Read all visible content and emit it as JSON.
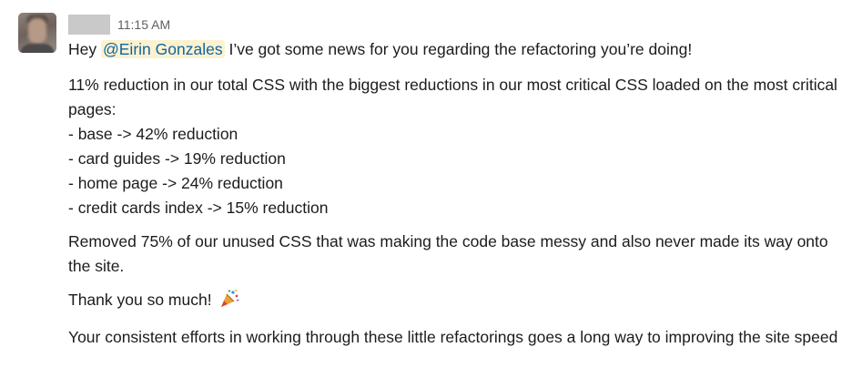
{
  "message": {
    "timestamp": "11:15 AM",
    "greeting": "Hey",
    "mention": "@Eirin Gonzales",
    "intro_rest": "I’ve got some news for you regarding the refactoring you’re doing!",
    "summary": "11% reduction in our total CSS with the biggest reductions in our most critical CSS loaded on the most critical pages:",
    "reductions": [
      "- base -> 42% reduction",
      "- card guides -> 19% reduction",
      "- home page -> 24% reduction",
      "- credit cards index -> 15% reduction"
    ],
    "unused": "Removed 75% of our unused CSS that was making the code base messy and also never made its way onto the site.",
    "thanks": "Thank you so much!",
    "thanks_emoji": "party-popper-icon",
    "closing": "Your consistent efforts in working through these little refactorings goes a long way to improving the site speed"
  },
  "colors": {
    "mention_bg": "#fdf2d0",
    "mention_text": "#1264a3",
    "timestamp": "#616061"
  }
}
